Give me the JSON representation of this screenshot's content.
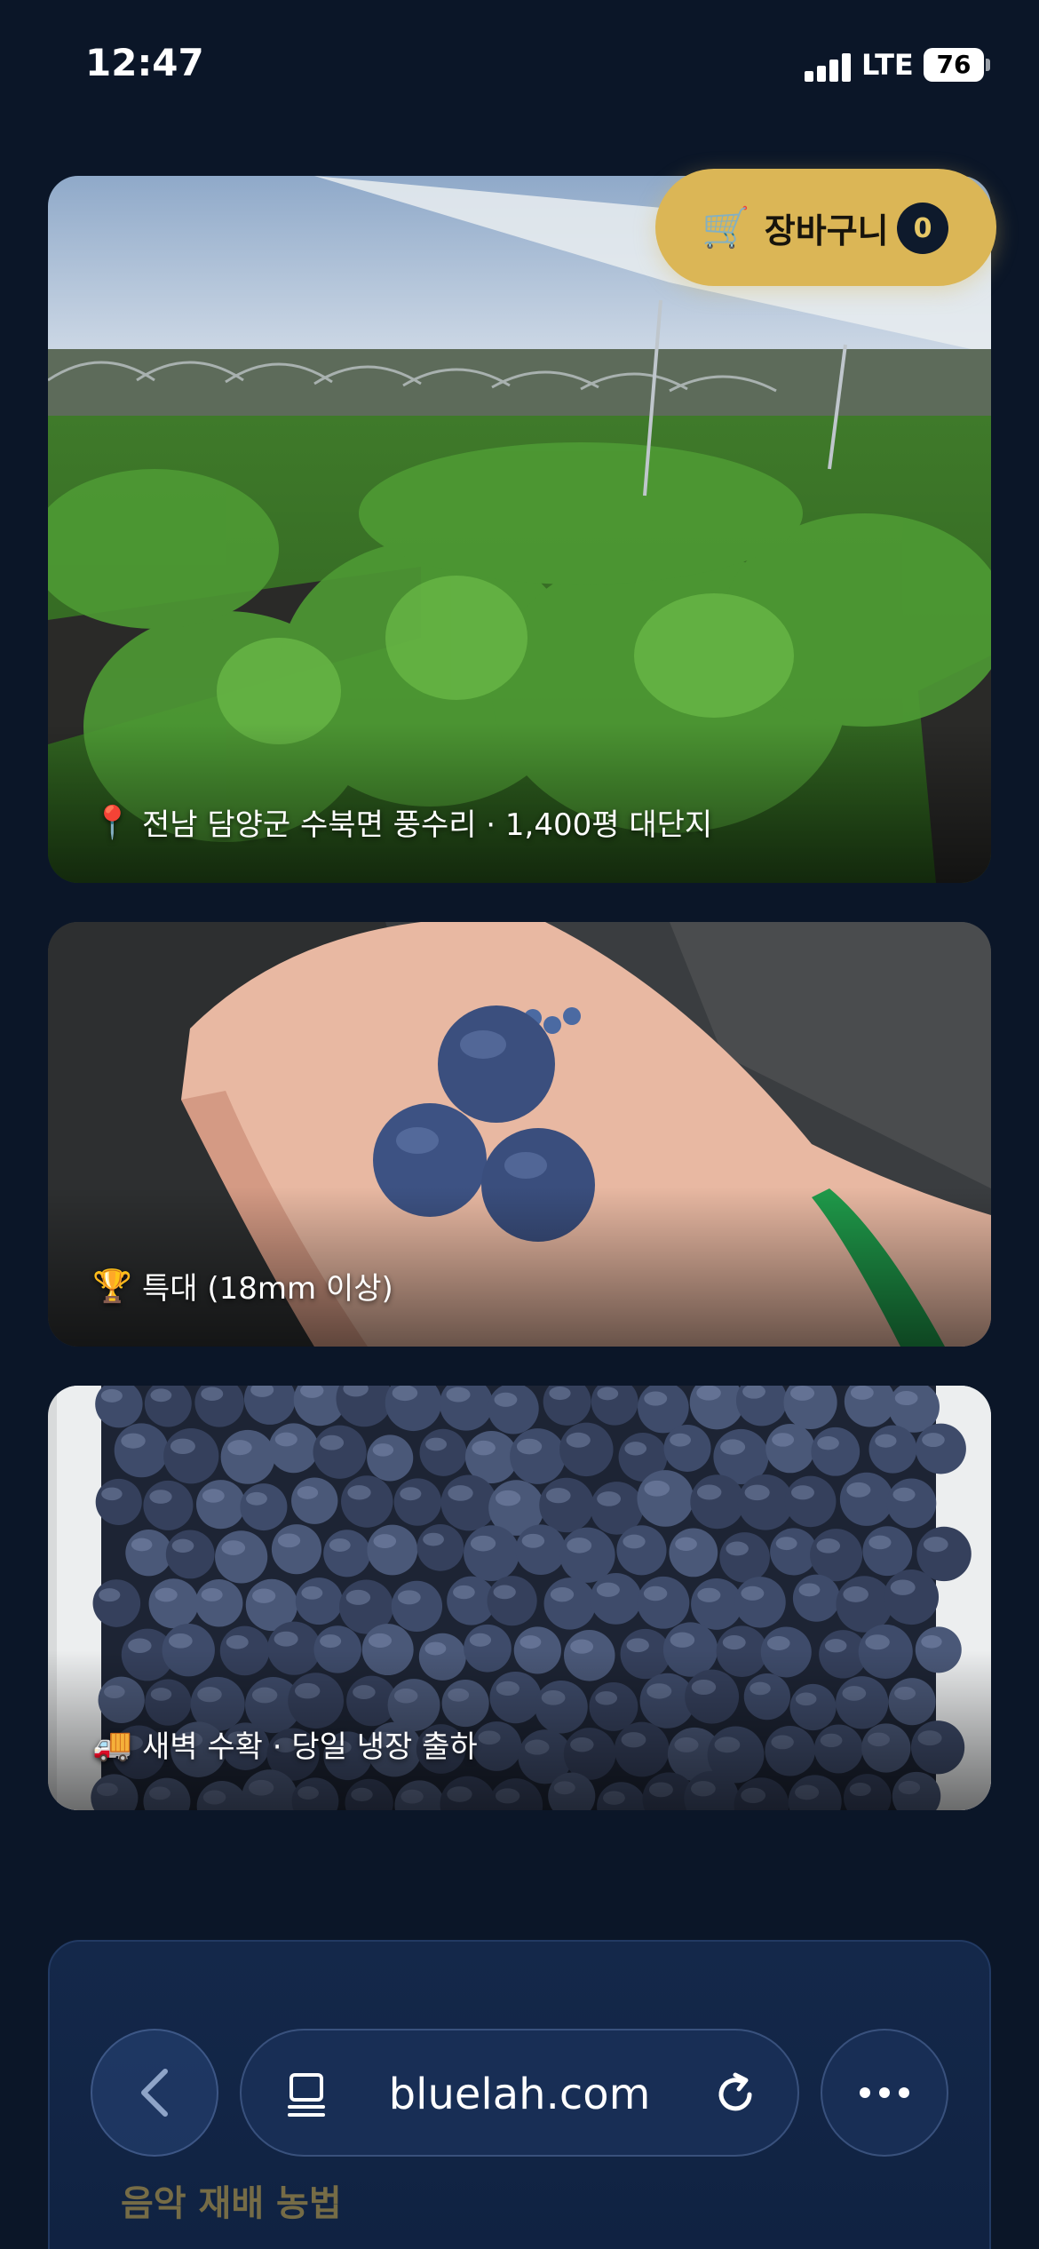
{
  "page": {
    "background_color": "#0b1628",
    "accent_color": "#dbb656"
  },
  "status_bar": {
    "time": "12:47",
    "network": "LTE",
    "battery": "76"
  },
  "cart": {
    "icon": "cart-icon",
    "label": "장바구니",
    "count": "0"
  },
  "gallery": [
    {
      "icon": "pin-icon",
      "icon_glyph": "📍",
      "caption": "전남 담양군 수북면 풍수리 · 1,400평 대단지"
    },
    {
      "icon": "trophy-icon",
      "icon_glyph": "🏆",
      "caption": "특대 (18mm 이상)"
    },
    {
      "icon": "truck-icon",
      "icon_glyph": "🚚",
      "caption": "새벽 수확 · 당일 냉장 출하"
    }
  ],
  "info_card": {
    "title": "음악 재배 농법"
  },
  "browser": {
    "url": "bluelah.com",
    "back_icon": "chevron-left-icon",
    "tabs_icon": "tabs-icon",
    "reload_icon": "reload-icon",
    "more_icon": "more-icon"
  }
}
